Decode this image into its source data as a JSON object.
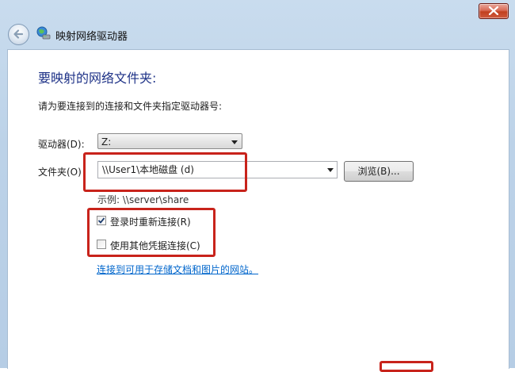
{
  "window": {
    "title": "映射网络驱动器"
  },
  "icons": {
    "back": "back-arrow-icon",
    "network_drive": "network-drive-icon",
    "close": "close-icon",
    "dropdown": "chevron-down-icon",
    "checkbox_check": "checkmark-icon"
  },
  "main": {
    "heading": "要映射的网络文件夹:",
    "instruction": "请为要连接到的连接和文件夹指定驱动器号:",
    "drive_label": "驱动器(D):",
    "drive_value": "Z:",
    "folder_label": "文件夹(O)",
    "folder_value": "\\\\User1\\本地磁盘 (d)",
    "browse_label": "浏览(B)...",
    "example": "示例: \\\\server\\share",
    "reconnect_label": "登录时重新连接(R)",
    "reconnect_checked": true,
    "credentials_label": "使用其他凭据连接(C)",
    "credentials_checked": false,
    "link_text": "连接到可用于存储文档和图片的网站。"
  },
  "colors": {
    "heading": "#1e3287",
    "link": "#0066cc",
    "highlight": "#c8231b"
  }
}
